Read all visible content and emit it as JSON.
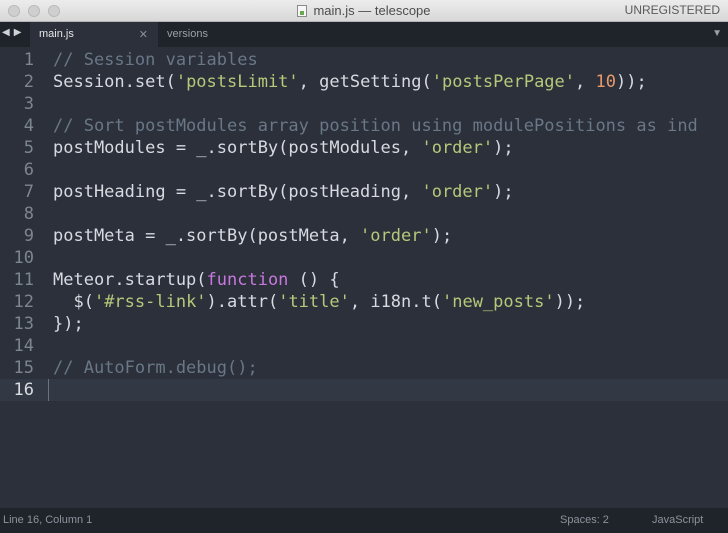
{
  "window": {
    "title": "main.js — telescope",
    "registration": "UNREGISTERED"
  },
  "tabs": [
    {
      "label": "main.js",
      "active": true
    },
    {
      "label": "versions",
      "active": false
    }
  ],
  "editor": {
    "current_line": 16,
    "lines": [
      {
        "num": "1",
        "tokens": [
          {
            "t": "// Session variables",
            "c": "comment"
          }
        ]
      },
      {
        "num": "2",
        "tokens": [
          {
            "t": "Session.set(",
            "c": ""
          },
          {
            "t": "'postsLimit'",
            "c": "string"
          },
          {
            "t": ", getSetting(",
            "c": ""
          },
          {
            "t": "'postsPerPage'",
            "c": "string"
          },
          {
            "t": ", ",
            "c": ""
          },
          {
            "t": "10",
            "c": "number"
          },
          {
            "t": "));",
            "c": ""
          }
        ]
      },
      {
        "num": "3",
        "tokens": []
      },
      {
        "num": "4",
        "tokens": [
          {
            "t": "// Sort postModules array position using modulePositions as ind",
            "c": "comment"
          }
        ]
      },
      {
        "num": "5",
        "tokens": [
          {
            "t": "postModules = _.sortBy(postModules, ",
            "c": ""
          },
          {
            "t": "'order'",
            "c": "string"
          },
          {
            "t": ");",
            "c": ""
          }
        ]
      },
      {
        "num": "6",
        "tokens": []
      },
      {
        "num": "7",
        "tokens": [
          {
            "t": "postHeading = _.sortBy(postHeading, ",
            "c": ""
          },
          {
            "t": "'order'",
            "c": "string"
          },
          {
            "t": ");",
            "c": ""
          }
        ]
      },
      {
        "num": "8",
        "tokens": []
      },
      {
        "num": "9",
        "tokens": [
          {
            "t": "postMeta = _.sortBy(postMeta, ",
            "c": ""
          },
          {
            "t": "'order'",
            "c": "string"
          },
          {
            "t": ");",
            "c": ""
          }
        ]
      },
      {
        "num": "10",
        "tokens": []
      },
      {
        "num": "11",
        "tokens": [
          {
            "t": "Meteor.startup(",
            "c": ""
          },
          {
            "t": "function",
            "c": "keyword"
          },
          {
            "t": " () {",
            "c": ""
          }
        ]
      },
      {
        "num": "12",
        "tokens": [
          {
            "t": "  $(",
            "c": ""
          },
          {
            "t": "'#rss-link'",
            "c": "string"
          },
          {
            "t": ").attr(",
            "c": ""
          },
          {
            "t": "'title'",
            "c": "string"
          },
          {
            "t": ", i18n.t(",
            "c": ""
          },
          {
            "t": "'new_posts'",
            "c": "string"
          },
          {
            "t": "));",
            "c": ""
          }
        ]
      },
      {
        "num": "13",
        "tokens": [
          {
            "t": "});",
            "c": ""
          }
        ]
      },
      {
        "num": "14",
        "tokens": []
      },
      {
        "num": "15",
        "tokens": [
          {
            "t": "// AutoForm.debug();",
            "c": "comment"
          }
        ]
      },
      {
        "num": "16",
        "tokens": []
      }
    ]
  },
  "statusbar": {
    "position": "Line 16, Column 1",
    "spaces": "Spaces: 2",
    "syntax": "JavaScript"
  },
  "icons": {
    "nav_back": "◀",
    "nav_forward": "▶",
    "tab_close": "✕",
    "overflow": "▼"
  }
}
